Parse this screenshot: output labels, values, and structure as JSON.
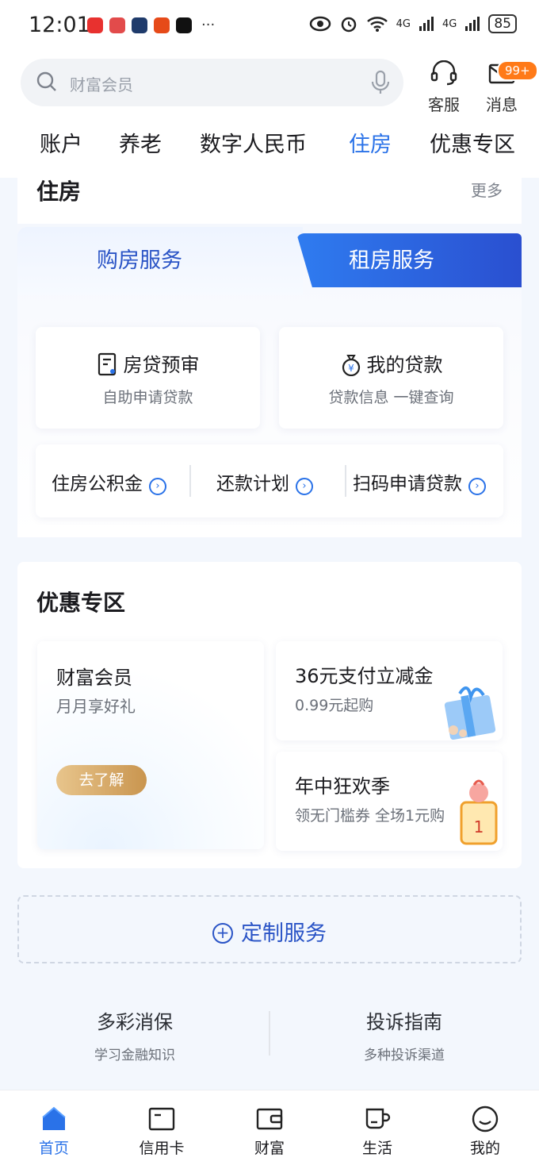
{
  "status_bar": {
    "time": "12:01",
    "dots": "···",
    "network1": "4G",
    "network2": "4G",
    "battery": "85"
  },
  "header": {
    "search_placeholder": "财富会员",
    "service_label": "客服",
    "message_label": "消息",
    "message_badge": "99+"
  },
  "tabs": [
    {
      "label": "账户"
    },
    {
      "label": "养老"
    },
    {
      "label": "数字人民币"
    },
    {
      "label": "住房"
    },
    {
      "label": "优惠专区"
    }
  ],
  "active_tab": "住房",
  "housing": {
    "title": "住房",
    "more": "更多",
    "seg_buy": "购房服务",
    "seg_rent": "租房服务",
    "services": [
      {
        "title": "房贷预审",
        "subtitle": "自助申请贷款",
        "icon": "document-icon"
      },
      {
        "title": "我的贷款",
        "subtitle": "贷款信息 一键查询",
        "icon": "money-bag-icon"
      }
    ],
    "links": [
      {
        "label": "住房公积金"
      },
      {
        "label": "还款计划"
      },
      {
        "label": "扫码申请贷款"
      }
    ]
  },
  "offers": {
    "title": "优惠专区",
    "big": {
      "title": "财富会员",
      "subtitle": "月月享好礼",
      "button": "去了解"
    },
    "items": [
      {
        "title": "36元支付立减金",
        "subtitle": "0.99元起购"
      },
      {
        "title": "年中狂欢季",
        "subtitle": "领无门槛券 全场1元购"
      }
    ]
  },
  "custom_service": "定制服务",
  "footer_links": [
    {
      "title": "多彩消保",
      "subtitle": "学习金融知识"
    },
    {
      "title": "投诉指南",
      "subtitle": "多种投诉渠道"
    }
  ],
  "nav": [
    {
      "label": "首页",
      "icon": "home-icon"
    },
    {
      "label": "信用卡",
      "icon": "card-icon"
    },
    {
      "label": "财富",
      "icon": "wallet-icon"
    },
    {
      "label": "生活",
      "icon": "cup-icon"
    },
    {
      "label": "我的",
      "icon": "smile-icon"
    }
  ],
  "colors": {
    "accent": "#2a72e8",
    "brand_dark": "#2a54c6",
    "badge": "#ff7a18",
    "gold": "#c9954f"
  }
}
